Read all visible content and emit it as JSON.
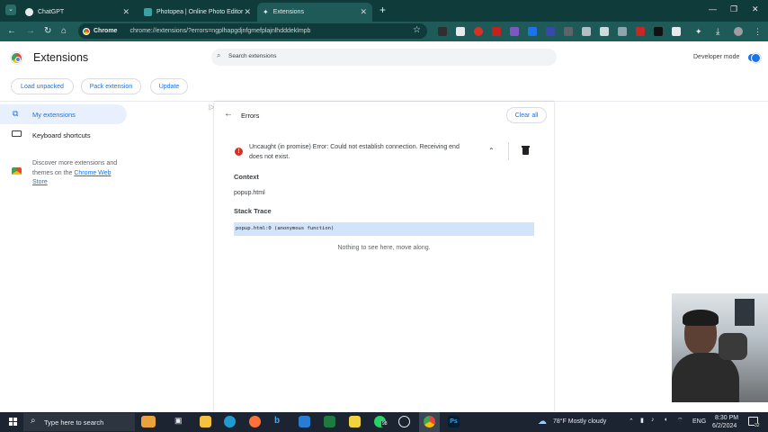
{
  "browser": {
    "tabs": [
      {
        "title": "ChatGPT",
        "active": false
      },
      {
        "title": "Photopea | Online Photo Editor",
        "active": false
      },
      {
        "title": "Extensions",
        "active": true
      }
    ],
    "new_tab": "+",
    "chip_label": "Chrome",
    "url": "chrome://extensions/?errors=ngplhapgdjnfgmefplajnlhdddeklmpb"
  },
  "page": {
    "title": "Extensions",
    "search_placeholder": "Search extensions",
    "developer_mode_label": "Developer mode",
    "developer_mode_on": true,
    "buttons": {
      "load_unpacked": "Load unpacked",
      "pack_extension": "Pack extension",
      "update": "Update"
    }
  },
  "sidebar": {
    "my_extensions": "My extensions",
    "keyboard_shortcuts": "Keyboard shortcuts",
    "discover_text": "Discover more extensions and themes on the ",
    "store_link": "Chrome Web Store"
  },
  "errors": {
    "title": "Errors",
    "clear_all": "Clear all",
    "error_message": "Uncaught (in promise) Error: Could not establish connection. Receiving end does not exist.",
    "context_heading": "Context",
    "context_value": "popup.html",
    "stack_heading": "Stack Trace",
    "stack_line": "popup.html:0 (anonymous function)",
    "nothing_msg": "Nothing to see here, move along."
  },
  "taskbar": {
    "search_placeholder": "Type here to search",
    "whatsapp_badge": "98",
    "weather": "78°F  Mostly cloudy",
    "language": "ENG",
    "time": "8:30 PM",
    "date": "6/2/2024",
    "notification_count": "32"
  },
  "colors": {
    "titlebar": "#0f3b3b",
    "toolbar": "#1e5a58",
    "accent": "#1a73e8",
    "error_red": "#d93025"
  }
}
